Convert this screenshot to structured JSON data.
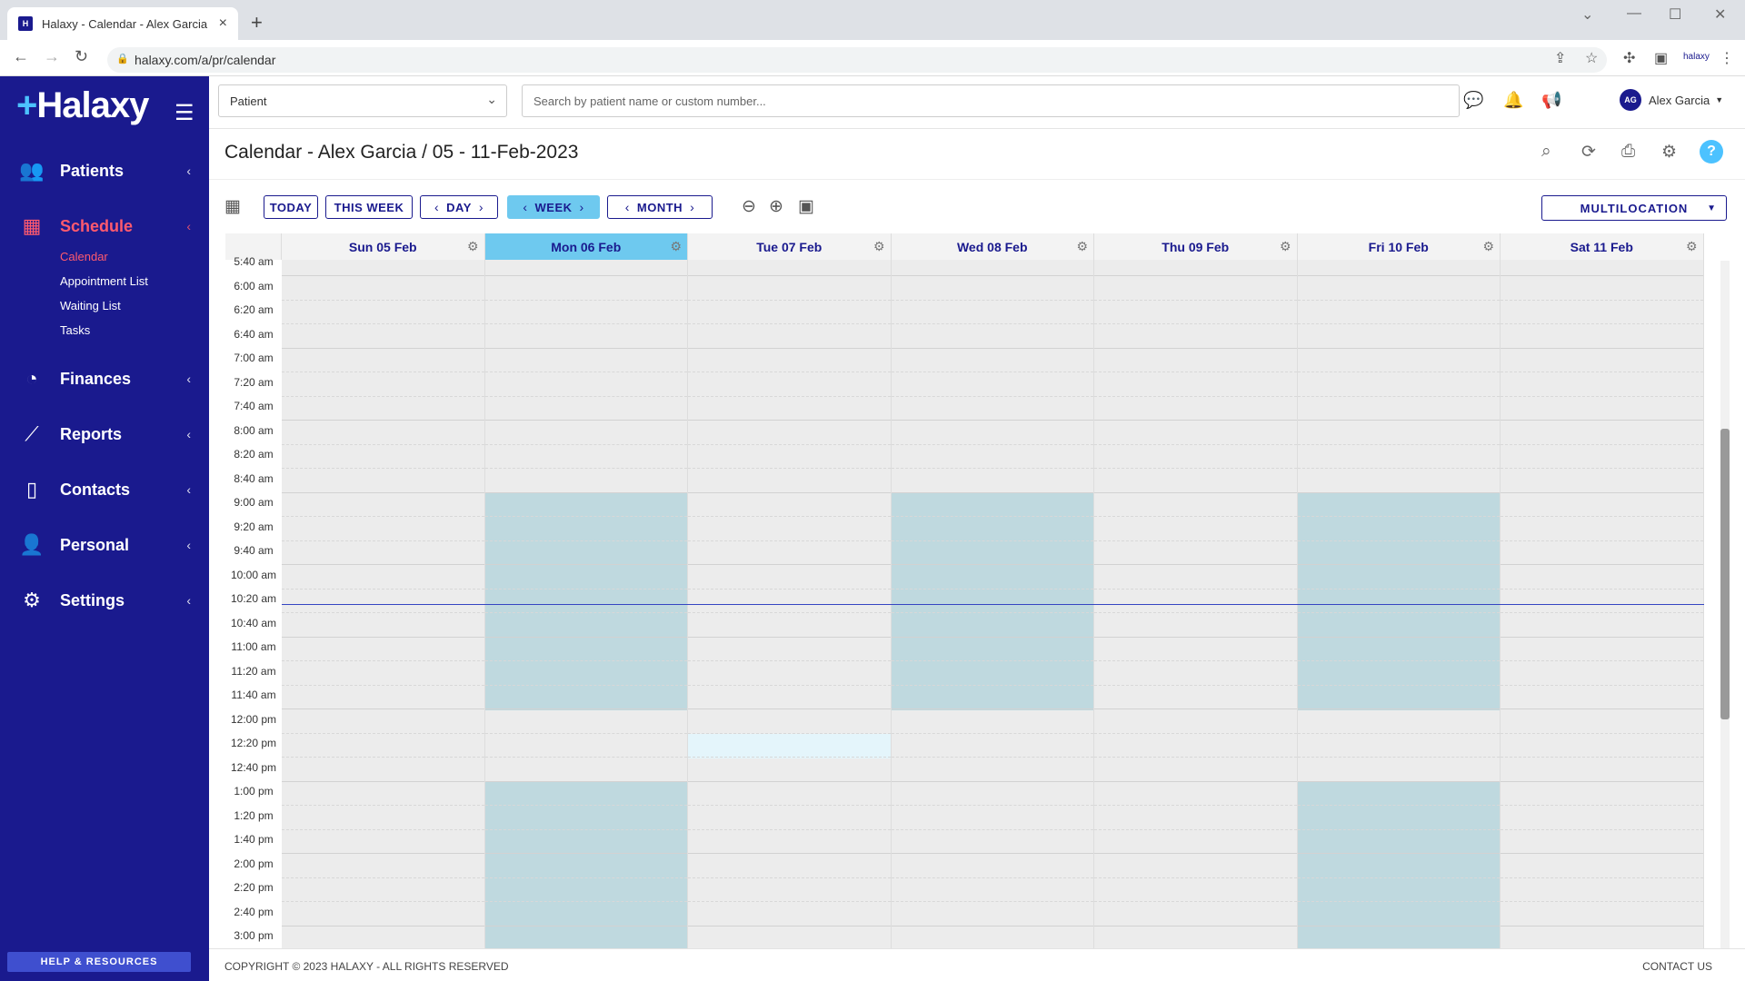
{
  "browser": {
    "tab_title": "Halaxy - Calendar - Alex Garcia",
    "url": "halaxy.com/a/pr/calendar"
  },
  "sidebar": {
    "logo": "Halaxy",
    "items": [
      {
        "label": "Patients",
        "icon": "patients-icon"
      },
      {
        "label": "Schedule",
        "icon": "calendar-icon",
        "active": true
      },
      {
        "label": "Finances",
        "icon": "pie-chart-icon"
      },
      {
        "label": "Reports",
        "icon": "chart-icon"
      },
      {
        "label": "Contacts",
        "icon": "book-icon"
      },
      {
        "label": "Personal",
        "icon": "user-icon"
      },
      {
        "label": "Settings",
        "icon": "gear-icon"
      }
    ],
    "schedule_sub": [
      "Calendar",
      "Appointment List",
      "Waiting List",
      "Tasks"
    ],
    "help_button": "HELP & RESOURCES"
  },
  "topbar": {
    "patient_select": "Patient",
    "search_placeholder": "Search by patient name or custom number...",
    "user_initials": "AG",
    "user_name": "Alex Garcia"
  },
  "calendar": {
    "title": "Calendar - Alex Garcia / 05 - 11-Feb-2023",
    "buttons": {
      "today": "TODAY",
      "this_week": "THIS WEEK",
      "day": "DAY",
      "week": "WEEK",
      "month": "MONTH",
      "multilocation": "MULTILOCATION"
    },
    "days": [
      "Sun 05 Feb",
      "Mon 06 Feb",
      "Tue 07 Feb",
      "Wed 08 Feb",
      "Thu 09 Feb",
      "Fri 10 Feb",
      "Sat 11 Feb"
    ],
    "active_day_index": 1,
    "times": [
      "5:40 am",
      "6:00 am",
      "6:20 am",
      "6:40 am",
      "7:00 am",
      "7:20 am",
      "7:40 am",
      "8:00 am",
      "8:20 am",
      "8:40 am",
      "9:00 am",
      "9:20 am",
      "9:40 am",
      "10:00 am",
      "10:20 am",
      "10:40 am",
      "11:00 am",
      "11:20 am",
      "11:40 am",
      "12:00 pm",
      "12:20 pm",
      "12:40 pm",
      "1:00 pm",
      "1:20 pm",
      "1:40 pm",
      "2:00 pm",
      "2:20 pm",
      "2:40 pm",
      "3:00 pm"
    ],
    "availability": [
      {
        "day": 1,
        "from": "9:00 am",
        "to": "12:00 pm"
      },
      {
        "day": 3,
        "from": "9:00 am",
        "to": "12:00 pm"
      },
      {
        "day": 5,
        "from": "9:00 am",
        "to": "12:00 pm"
      },
      {
        "day": 1,
        "from": "1:00 pm",
        "to": "3:20 pm"
      },
      {
        "day": 5,
        "from": "1:00 pm",
        "to": "3:20 pm"
      }
    ],
    "hover_slot": {
      "day": 2,
      "time": "12:20 pm"
    },
    "now_time": "10:25 am"
  },
  "footer": {
    "copyright": "COPYRIGHT © 2023 HALAXY - ALL RIGHTS RESERVED",
    "contact": "CONTACT US"
  },
  "colors": {
    "brand": "#1a1a8e",
    "accent": "#ff5a6e",
    "active_day": "#6ec9ef",
    "availability": "#bfd9df"
  }
}
